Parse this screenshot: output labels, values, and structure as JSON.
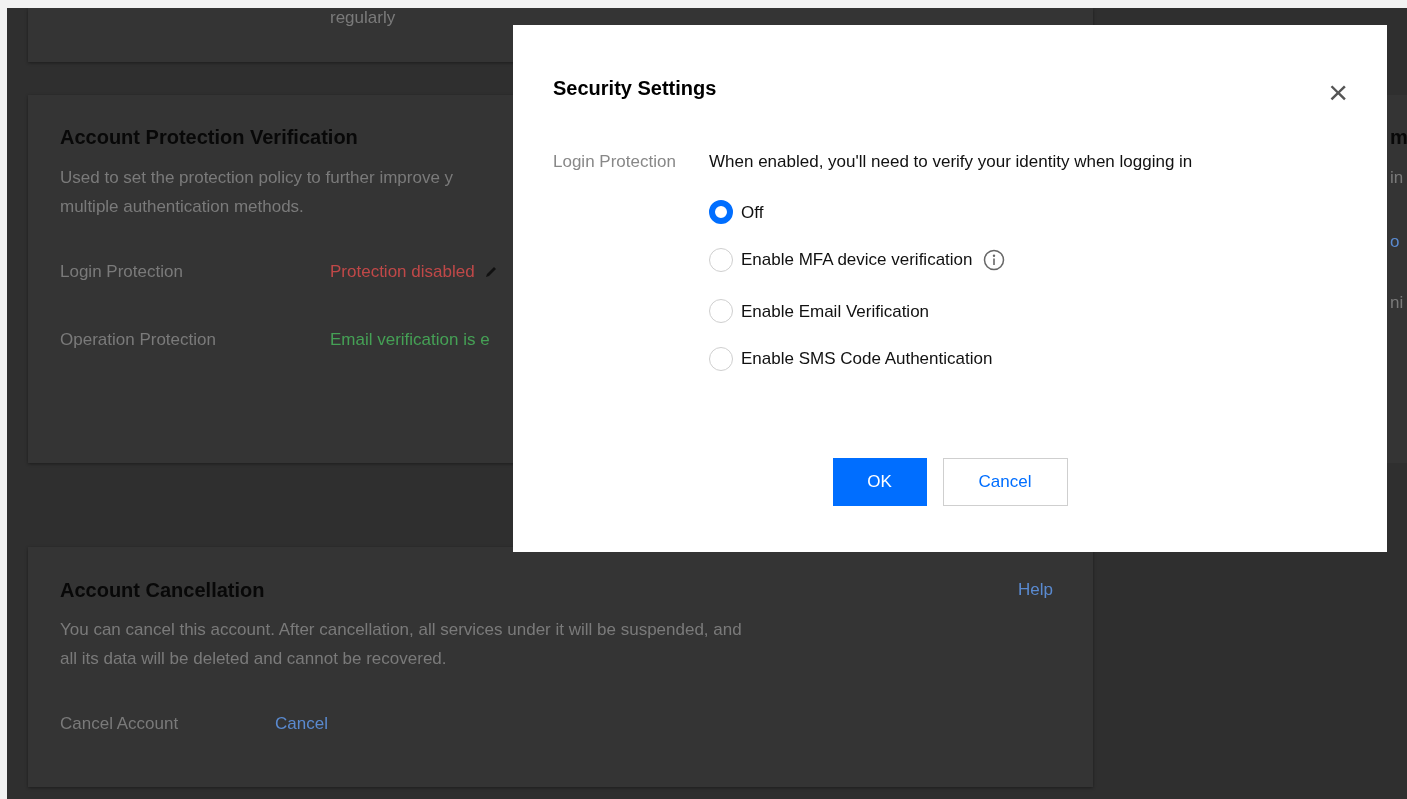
{
  "top_card": {
    "text": "regularly"
  },
  "protection_card": {
    "title": "Account Protection Verification",
    "description": "Used to set the protection policy to further improve y\nmultiple authentication methods.",
    "rows": [
      {
        "label": "Login Protection",
        "value": "Protection disabled",
        "kind": "error",
        "editable": true
      },
      {
        "label": "Operation Protection",
        "value": "Email verification is e",
        "kind": "success",
        "editable": false
      }
    ]
  },
  "side_card": {
    "title": "m",
    "line_1": "in",
    "link": "o",
    "line_2": "ni"
  },
  "cancellation_card": {
    "title": "Account Cancellation",
    "help": "Help",
    "description": "You can cancel this account. After cancellation, all services under it will be suspended, and\nall its data will be deleted and cannot be recovered.",
    "row": {
      "label": "Cancel Account",
      "link": "Cancel"
    }
  },
  "dialog": {
    "title": "Security Settings",
    "close": "×",
    "label": "Login Protection",
    "hint": "When enabled, you'll need to verify your identity when logging in",
    "options": [
      {
        "label": "Off",
        "selected": true,
        "info": false
      },
      {
        "label": "Enable MFA device verification",
        "selected": false,
        "info": true
      },
      {
        "label": "Enable Email Verification",
        "selected": false,
        "info": false
      },
      {
        "label": "Enable SMS Code Authentication",
        "selected": false,
        "info": false
      }
    ],
    "buttons": [
      {
        "label": "OK",
        "kind": "primary"
      },
      {
        "label": "Cancel",
        "kind": "secondary"
      }
    ]
  }
}
